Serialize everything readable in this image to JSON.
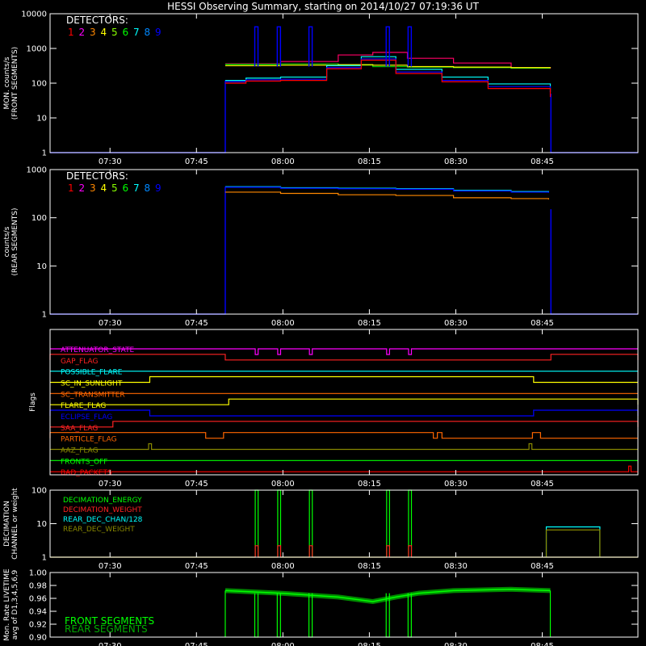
{
  "title": "HESSI Observing Summary, starting on 2014/10/27 07:19:36 UT",
  "time_ticks": [
    "07:30",
    "07:45",
    "08:00",
    "08:15",
    "08:30",
    "08:45"
  ],
  "time_tick_minutes": [
    10.4,
    25.4,
    40.4,
    55.4,
    70.4,
    85.4
  ],
  "time_range_minutes": [
    0,
    102
  ],
  "detector_colors": [
    "#ff0000",
    "#ff00ff",
    "#ff8800",
    "#ffff00",
    "#88ff00",
    "#00ff00",
    "#00ffff",
    "#0088ff",
    "#0000ff"
  ],
  "chart_data": [
    {
      "type": "line",
      "ylabel": "MON. counts/s (FRONT SEGMENTS)",
      "ylabel_lines": [
        "MON. counts/s",
        "(FRONT SEGMENTS)"
      ],
      "scale": "log",
      "ylim": [
        1,
        10000
      ],
      "ytick_labels": [
        "1",
        "10",
        "100",
        "1000",
        "10000"
      ],
      "ytick_values": [
        1,
        10,
        100,
        1000,
        10000
      ],
      "legend_title": "DETECTORS:",
      "legend_labels": [
        "1",
        "2",
        "3",
        "4",
        "5",
        "6",
        "7",
        "8",
        "9"
      ],
      "observation_window_minutes": [
        30.4,
        86.9
      ],
      "spike_minutes": [
        35.8,
        39.7,
        45.2,
        58.6,
        62.4
      ],
      "spike_peak": 4200,
      "series": [
        {
          "color": "#ff0066",
          "x": [
            30.4,
            40,
            50,
            56,
            62,
            70,
            80,
            86.8
          ],
          "y": [
            360,
            420,
            650,
            770,
            520,
            380,
            280,
            260
          ]
        },
        {
          "color": "#00cc00",
          "x": [
            30.4,
            40,
            50,
            56,
            62,
            70,
            80,
            86.8
          ],
          "y": [
            350,
            360,
            330,
            300,
            290,
            280,
            270,
            270
          ]
        },
        {
          "color": "#ffff00",
          "x": [
            30.4,
            40,
            50,
            56,
            62,
            70,
            80,
            86.8
          ],
          "y": [
            320,
            330,
            340,
            330,
            300,
            290,
            280,
            275
          ]
        },
        {
          "color": "#00ffff",
          "x": [
            30.4,
            34,
            40,
            48,
            54,
            60,
            68,
            76,
            86.8
          ],
          "y": [
            120,
            140,
            150,
            320,
            580,
            250,
            150,
            95,
            55
          ]
        },
        {
          "color": "#0000ff",
          "x": [
            30.4,
            34,
            40,
            48,
            54,
            60,
            68,
            76,
            86.8
          ],
          "y": [
            110,
            125,
            130,
            280,
            500,
            210,
            120,
            80,
            45
          ]
        },
        {
          "color": "#ff0000",
          "x": [
            30.4,
            34,
            40,
            48,
            54,
            60,
            68,
            76,
            86.8
          ],
          "y": [
            100,
            115,
            120,
            260,
            460,
            190,
            110,
            70,
            40
          ]
        }
      ]
    },
    {
      "type": "line",
      "ylabel": "counts/s (REAR SEGMENTS)",
      "ylabel_lines": [
        "counts/s",
        "(REAR SEGMENTS)"
      ],
      "scale": "log",
      "ylim": [
        1,
        1000
      ],
      "ytick_labels": [
        "1",
        "10",
        "100",
        "1000"
      ],
      "ytick_values": [
        1,
        10,
        100,
        1000
      ],
      "legend_title": "DETECTORS:",
      "legend_labels": [
        "1",
        "2",
        "3",
        "4",
        "5",
        "6",
        "7",
        "8",
        "9"
      ],
      "observation_window_minutes": [
        30.4,
        86.9
      ],
      "series": [
        {
          "color": "#00ffff",
          "x": [
            30.4,
            40,
            50,
            60,
            70,
            80,
            86.5
          ],
          "y": [
            440,
            420,
            410,
            400,
            370,
            350,
            340
          ]
        },
        {
          "color": "#0000ff",
          "x": [
            30.4,
            40,
            50,
            60,
            70,
            80,
            86.5
          ],
          "y": [
            430,
            410,
            400,
            390,
            360,
            340,
            330
          ]
        },
        {
          "color": "#ff8800",
          "x": [
            30.4,
            40,
            50,
            60,
            70,
            80,
            86.5
          ],
          "y": [
            340,
            320,
            300,
            290,
            260,
            250,
            240
          ]
        }
      ]
    },
    {
      "type": "flags",
      "ylabel": "Flags",
      "flags": [
        {
          "name": "ATTENUATOR_STATE",
          "color": "#ff00ff",
          "high_intervals": [
            [
              35.6,
              36.1
            ],
            [
              39.5,
              40.0
            ],
            [
              45.0,
              45.5
            ],
            [
              58.4,
              58.9
            ],
            [
              62.2,
              62.7
            ]
          ],
          "toggle": "down"
        },
        {
          "name": "GAP_FLAG",
          "color": "#ff2222",
          "high_intervals": [
            [
              0,
              30.4
            ],
            [
              86.9,
              102
            ]
          ]
        },
        {
          "name": "POSSIBLE_FLARE",
          "color": "#00ffff",
          "high_intervals": []
        },
        {
          "name": "SC_IN_SUNLIGHT",
          "color": "#ffff00",
          "high_intervals": [
            [
              17.3,
              83.9
            ]
          ]
        },
        {
          "name": "SC_TRANSMITTER",
          "color": "#ff6600",
          "high_intervals": []
        },
        {
          "name": "FLARE_FLAG",
          "color": "#ffff00",
          "high_intervals": [
            [
              31.0,
              102
            ]
          ]
        },
        {
          "name": "ECLIPSE_FLAG",
          "color": "#0000ff",
          "high_intervals": [
            [
              0,
              17.3
            ],
            [
              83.9,
              102
            ]
          ]
        },
        {
          "name": "SAA_FLAG",
          "color": "#ff2222",
          "high_intervals": [
            [
              10.9,
              102
            ]
          ]
        },
        {
          "name": "PARTICLE_FLAG",
          "color": "#ff6600",
          "high_intervals": [
            [
              0,
              27.0
            ],
            [
              30.1,
              66.5
            ],
            [
              67.2,
              68.0
            ],
            [
              83.7,
              85.1
            ]
          ]
        },
        {
          "name": "AAZ_FLAG",
          "color": "#888800",
          "high_intervals": [
            [
              17.1,
              17.6
            ],
            [
              83.1,
              83.6
            ]
          ]
        },
        {
          "name": "FRONTS_OFF",
          "color": "#00ff00",
          "high_intervals": []
        },
        {
          "name": "BAD_PACKETS",
          "color": "#ff0000",
          "high_intervals": [
            [
              100.4,
              100.8
            ]
          ]
        }
      ]
    },
    {
      "type": "line",
      "ylabel": "DECIMATION CHANNEL or weight",
      "ylabel_lines": [
        "DECIMATION",
        "CHANNEL or weight"
      ],
      "scale": "log",
      "ylim": [
        1,
        100
      ],
      "ytick_labels": [
        "1",
        "10",
        "100"
      ],
      "ytick_values": [
        1,
        10,
        100
      ],
      "series": [
        {
          "name": "DECIMATION_ENERGY",
          "color": "#00ff00"
        },
        {
          "name": "DECIMATION_WEIGHT",
          "color": "#ff2222"
        },
        {
          "name": "REAR_DEC_CHAN/128",
          "color": "#00ffff"
        },
        {
          "name": "REAR_DEC_WEIGHT",
          "color": "#888800"
        }
      ],
      "energy_pulses_minutes": [
        [
          35.6,
          36.1
        ],
        [
          39.5,
          40.0
        ],
        [
          45.0,
          45.5
        ],
        [
          58.4,
          58.9
        ],
        [
          62.2,
          62.7
        ]
      ],
      "energy_pulse_value": 100,
      "weight_pulse_value": 2.2,
      "rear_dec_chan_level": 8,
      "rear_dec_weight_level": 6.5,
      "rear_dec_window_minutes": [
        86.1,
        95.4
      ]
    },
    {
      "type": "line",
      "ylabel": "Mon. Rate LIVETIME avg of D1,3,4,5,6,9",
      "ylabel_lines": [
        "Mon. Rate LIVETIME",
        "avg of D1,3,4,5,6,9"
      ],
      "ylim": [
        0.9,
        1.0
      ],
      "ytick_labels": [
        "0.90",
        "0.92",
        "0.94",
        "0.96",
        "0.98",
        "1.00"
      ],
      "ytick_values": [
        0.9,
        0.92,
        0.94,
        0.96,
        0.98,
        1.0
      ],
      "series": [
        {
          "name": "FRONT SEGMENTS",
          "color": "#00ff00",
          "x": [
            30.4,
            40,
            50,
            56,
            60,
            64,
            70,
            80,
            86.8
          ],
          "y": [
            0.972,
            0.968,
            0.962,
            0.955,
            0.962,
            0.968,
            0.972,
            0.974,
            0.972
          ]
        },
        {
          "name": "REAR SEGMENTS",
          "color": "#00aa00"
        }
      ],
      "dip_minutes": [
        35.8,
        39.7,
        45.2,
        58.6,
        62.4
      ]
    }
  ]
}
